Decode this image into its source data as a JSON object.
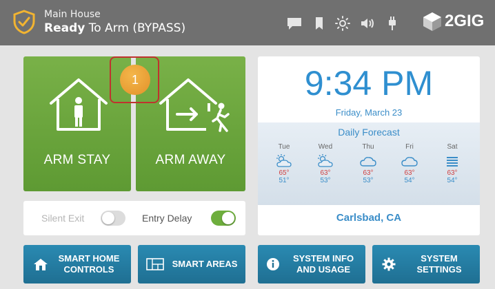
{
  "header": {
    "location": "Main House",
    "status_bold": "Ready",
    "status_rest": " To Arm (BYPASS)",
    "brand": "2GIG",
    "icons": [
      "message-icon",
      "bookmark-icon",
      "brightness-icon",
      "volume-icon",
      "plug-icon"
    ]
  },
  "arm": {
    "stay_label": "ARM STAY",
    "away_label": "ARM AWAY",
    "badge_count": "1"
  },
  "toggles": {
    "silent_exit_label": "Silent Exit",
    "silent_exit_on": false,
    "entry_delay_label": "Entry Delay",
    "entry_delay_on": true
  },
  "clock": {
    "time": "9:34 PM",
    "date": "Friday, March 23"
  },
  "forecast": {
    "title": "Daily Forecast",
    "days": [
      {
        "name": "Tue",
        "icon": "partly-sunny-icon",
        "hi": "65°",
        "lo": "51°"
      },
      {
        "name": "Wed",
        "icon": "partly-sunny-icon",
        "hi": "63°",
        "lo": "53°"
      },
      {
        "name": "Thu",
        "icon": "cloud-icon",
        "hi": "63°",
        "lo": "53°"
      },
      {
        "name": "Fri",
        "icon": "cloud-icon",
        "hi": "63°",
        "lo": "54°"
      },
      {
        "name": "Sat",
        "icon": "fog-icon",
        "hi": "63°",
        "lo": "54°"
      }
    ],
    "city": "Carlsbad, CA"
  },
  "buttons": {
    "smart_home_line1": "SMART HOME",
    "smart_home_line2": "CONTROLS",
    "smart_areas": "SMART AREAS",
    "system_info_line1": "SYSTEM INFO",
    "system_info_line2": "AND USAGE",
    "system_settings_line1": "SYSTEM",
    "system_settings_line2": "SETTINGS"
  },
  "colors": {
    "header_bg": "#707070",
    "arm_green": "#6aa63b",
    "accent_blue": "#2f8fd0",
    "button_blue": "#2581a8",
    "badge_orange": "#e9a238",
    "highlight_red": "#c0322e"
  }
}
